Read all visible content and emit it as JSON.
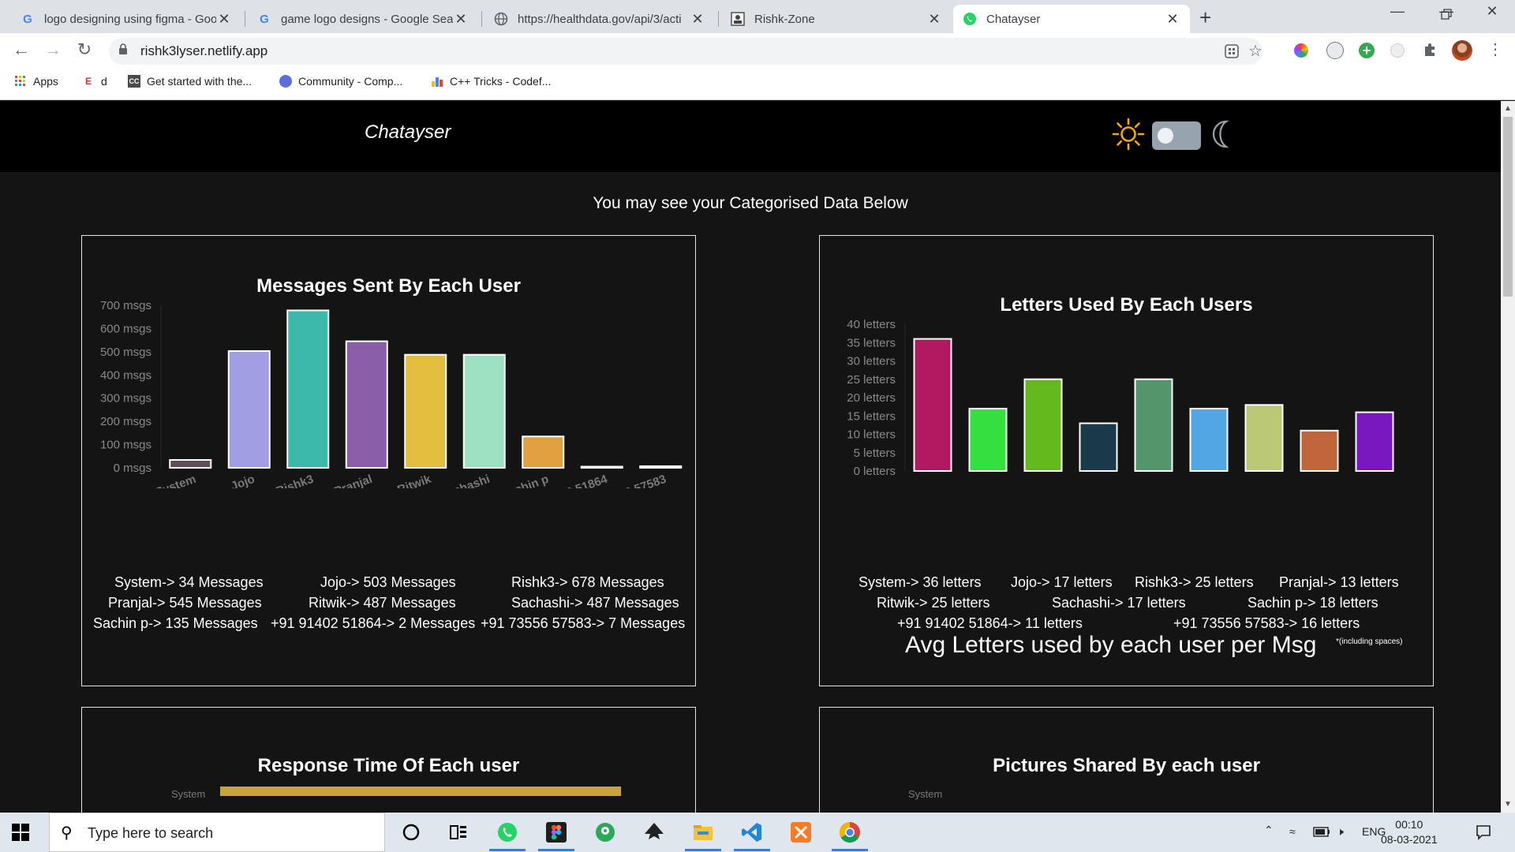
{
  "browser": {
    "tabs": [
      {
        "title": "logo designing using figma - Goo",
        "icon": "google-icon",
        "close": "✕"
      },
      {
        "title": "game logo designs - Google Sear",
        "icon": "google-icon",
        "close": "✕"
      },
      {
        "title": "https://healthdata.gov/api/3/acti",
        "icon": "globe-icon",
        "close": "✕"
      },
      {
        "title": "Rishk-Zone",
        "icon": "site-icon",
        "close": "✕"
      },
      {
        "title": "Chatayser",
        "icon": "whatsapp-icon",
        "close": "✕"
      }
    ],
    "new_tab": "+",
    "url": "rishk3lyser.netlify.app",
    "bookmarks": [
      {
        "label": "Apps",
        "icon": "apps-grid-icon"
      },
      {
        "label": "d",
        "icon": "e-icon"
      },
      {
        "label": "Get started with the...",
        "icon": "cc-icon"
      },
      {
        "label": "Community - Comp...",
        "icon": "community-icon"
      },
      {
        "label": "C++ Tricks - Codef...",
        "icon": "bar-chart-icon"
      }
    ]
  },
  "site": {
    "title": "Chatayser",
    "subtitle": "You may see your Categorised Data Below",
    "theme_toggle": "off"
  },
  "chart_data": [
    {
      "type": "bar",
      "title": "Messages Sent By Each User",
      "categories": [
        "System",
        "Jojo",
        "Rishk3",
        "Pranjal",
        "Ritwik",
        "Sachashi",
        "Sachin p",
        "+91 91402 51864",
        "+91 73556 57583"
      ],
      "values": [
        34,
        503,
        678,
        545,
        487,
        487,
        135,
        2,
        7
      ],
      "colors": [
        "#5e4f5a",
        "#a29ee3",
        "#3cb9ab",
        "#8a5ea8",
        "#e3bd3d",
        "#9ee0c2",
        "#e0a040",
        "#3a3a3a",
        "#5ab4d0"
      ],
      "yticks": [
        "0 msgs",
        "100 msgs",
        "200 msgs",
        "300 msgs",
        "400 msgs",
        "500 msgs",
        "600 msgs",
        "700 msgs"
      ],
      "ylim": [
        0,
        700
      ]
    },
    {
      "type": "bar",
      "title": "Letters Used By Each Users",
      "categories": [
        "System",
        "Jojo",
        "Rishk3",
        "Pranjal",
        "Ritwik",
        "Sachashi",
        "Sachin p",
        "+91 91402 51864",
        "+91 73556 57583"
      ],
      "values": [
        36,
        17,
        25,
        13,
        25,
        17,
        18,
        11,
        16
      ],
      "colors": [
        "#b0185f",
        "#33e040",
        "#63b81c",
        "#1a3a4c",
        "#54956b",
        "#52a6e3",
        "#bac875",
        "#c0643c",
        "#7a18c0"
      ],
      "yticks": [
        "0 letters",
        "5 letters",
        "10 letters",
        "15 letters",
        "20 letters",
        "25 letters",
        "30 letters",
        "35 letters",
        "40 letters"
      ],
      "ylim": [
        0,
        40
      ]
    }
  ],
  "messages_stats": [
    "System-> 34 Messages",
    "Jojo-> 503 Messages",
    "Rishk3-> 678 Messages",
    "Pranjal-> 545 Messages",
    "Ritwik-> 487 Messages",
    "Sachashi-> 487 Messages",
    "Sachin p-> 135 Messages",
    "+91 91402 51864-> 2 Messages",
    "+91 73556 57583-> 7 Messages"
  ],
  "letters_stats": [
    "System-> 36 letters",
    "Jojo-> 17 letters",
    "Rishk3-> 25 letters",
    "Pranjal-> 13 letters",
    "Ritwik-> 25 letters",
    "Sachashi-> 17 letters",
    "Sachin p-> 18 letters",
    "+91 91402 51864-> 11 letters",
    "+91 73556 57583-> 16 letters"
  ],
  "letters_caption": "Avg Letters used by each user per Msg",
  "letters_note": "*(including spaces)",
  "lower_cards": {
    "response_title": "Response Time Of Each user",
    "response_first_label": "System",
    "pictures_title": "Pictures Shared By each user",
    "pictures_first_label": "System"
  },
  "taskbar": {
    "search_placeholder": "Type here to search",
    "language": "ENG",
    "time": "00:10",
    "date": "08-03-2021"
  }
}
